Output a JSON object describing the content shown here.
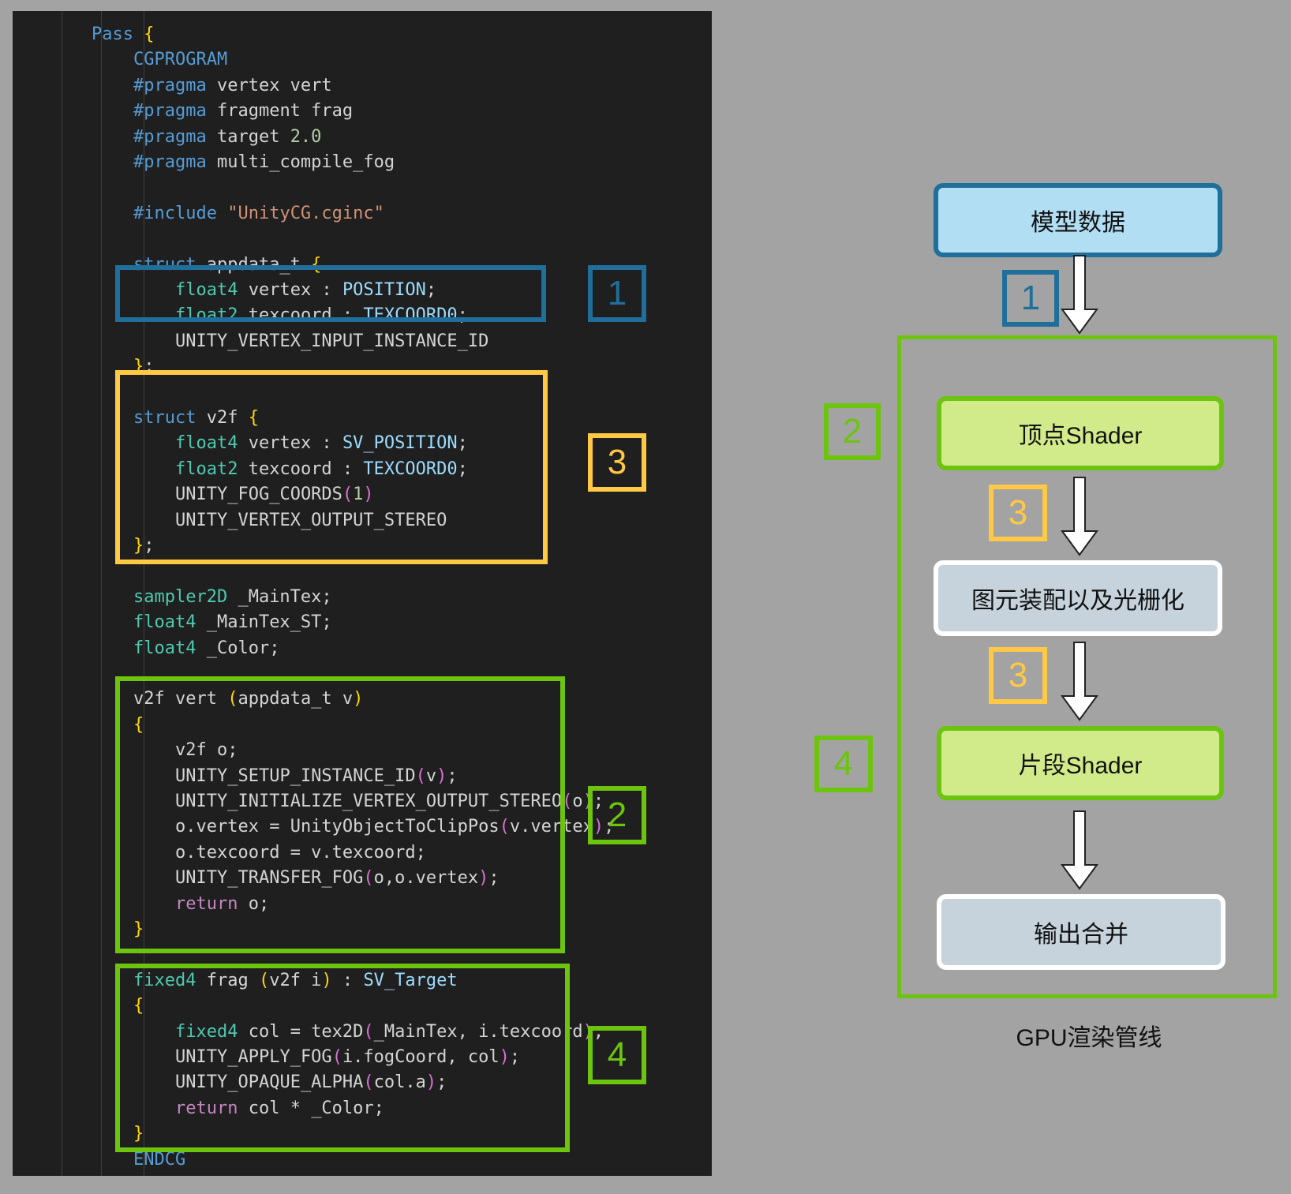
{
  "colors": {
    "blue": "#1f6f9a",
    "yellow": "#ffc845",
    "green": "#6cc40f",
    "model_node_fill": "#b1def3",
    "shader_node_fill": "#d1eb8a",
    "gray_node_fill": "#c6d3dd",
    "code_bg": "#1f1f1f",
    "page_bg": "#a3a3a3"
  },
  "code": {
    "lines": [
      [
        [
          "t-kw",
          "Pass "
        ],
        [
          "t-br",
          "{"
        ]
      ],
      [
        [
          "t-kw",
          "CGPROGRAM"
        ]
      ],
      [
        [
          "t-pre",
          "#pragma "
        ],
        [
          "t-tx",
          "vertex vert"
        ]
      ],
      [
        [
          "t-pre",
          "#pragma "
        ],
        [
          "t-tx",
          "fragment frag"
        ]
      ],
      [
        [
          "t-pre",
          "#pragma "
        ],
        [
          "t-tx",
          "target "
        ],
        [
          "t-num",
          "2.0"
        ]
      ],
      [
        [
          "t-pre",
          "#pragma "
        ],
        [
          "t-tx",
          "multi_compile_fog"
        ]
      ],
      [],
      [
        [
          "t-pre",
          "#include "
        ],
        [
          "t-str",
          "\"UnityCG.cginc\""
        ]
      ],
      [],
      [
        [
          "t-kw",
          "struct "
        ],
        [
          "t-tx",
          "appdata_t "
        ],
        [
          "t-br",
          "{"
        ]
      ],
      [
        [
          "t-type",
          "float4 "
        ],
        [
          "t-tx",
          "vertex : "
        ],
        [
          "t-pl",
          "POSITION"
        ],
        [
          "t-tx",
          ";"
        ]
      ],
      [
        [
          "t-type",
          "float2 "
        ],
        [
          "t-tx",
          "texcoord : "
        ],
        [
          "t-pl",
          "TEXCOORD0"
        ],
        [
          "t-tx",
          ";"
        ]
      ],
      [
        [
          "t-tx",
          "UNITY_VERTEX_INPUT_INSTANCE_ID"
        ]
      ],
      [
        [
          "t-br",
          "}"
        ],
        [
          "t-tx",
          ";"
        ]
      ],
      [],
      [
        [
          "t-kw",
          "struct "
        ],
        [
          "t-tx",
          "v2f "
        ],
        [
          "t-br",
          "{"
        ]
      ],
      [
        [
          "t-type",
          "float4 "
        ],
        [
          "t-tx",
          "vertex : "
        ],
        [
          "t-pl",
          "SV_POSITION"
        ],
        [
          "t-tx",
          ";"
        ]
      ],
      [
        [
          "t-type",
          "float2 "
        ],
        [
          "t-tx",
          "texcoord : "
        ],
        [
          "t-pl",
          "TEXCOORD0"
        ],
        [
          "t-tx",
          ";"
        ]
      ],
      [
        [
          "t-tx",
          "UNITY_FOG_COORDS"
        ],
        [
          "t-pa",
          "("
        ],
        [
          "t-num",
          "1"
        ],
        [
          "t-pa",
          ")"
        ]
      ],
      [
        [
          "t-tx",
          "UNITY_VERTEX_OUTPUT_STEREO"
        ]
      ],
      [
        [
          "t-br",
          "}"
        ],
        [
          "t-tx",
          ";"
        ]
      ],
      [],
      [
        [
          "t-type",
          "sampler2D "
        ],
        [
          "t-tx",
          "_MainTex;"
        ]
      ],
      [
        [
          "t-type",
          "float4 "
        ],
        [
          "t-tx",
          "_MainTex_ST;"
        ]
      ],
      [
        [
          "t-type",
          "float4 "
        ],
        [
          "t-tx",
          "_Color;"
        ]
      ],
      [],
      [
        [
          "t-tx",
          "v2f vert "
        ],
        [
          "t-br",
          "("
        ],
        [
          "t-tx",
          "appdata_t v"
        ],
        [
          "t-br",
          ")"
        ]
      ],
      [
        [
          "t-br",
          "{"
        ]
      ],
      [
        [
          "t-tx",
          "v2f o;"
        ]
      ],
      [
        [
          "t-tx",
          "UNITY_SETUP_INSTANCE_ID"
        ],
        [
          "t-pa",
          "("
        ],
        [
          "t-tx",
          "v"
        ],
        [
          "t-pa",
          ")"
        ],
        [
          "t-tx",
          ";"
        ]
      ],
      [
        [
          "t-tx",
          "UNITY_INITIALIZE_VERTEX_OUTPUT_STEREO"
        ],
        [
          "t-pa",
          "("
        ],
        [
          "t-tx",
          "o"
        ],
        [
          "t-pa",
          ")"
        ],
        [
          "t-tx",
          ";"
        ]
      ],
      [
        [
          "t-tx",
          "o.vertex = UnityObjectToClipPos"
        ],
        [
          "t-pa",
          "("
        ],
        [
          "t-tx",
          "v.vertex"
        ],
        [
          "t-pa",
          ")"
        ],
        [
          "t-tx",
          ";"
        ]
      ],
      [
        [
          "t-tx",
          "o.texcoord = v.texcoord;"
        ]
      ],
      [
        [
          "t-tx",
          "UNITY_TRANSFER_FOG"
        ],
        [
          "t-pa",
          "("
        ],
        [
          "t-tx",
          "o,o.vertex"
        ],
        [
          "t-pa",
          ")"
        ],
        [
          "t-tx",
          ";"
        ]
      ],
      [
        [
          "t-ret",
          "return "
        ],
        [
          "t-tx",
          "o;"
        ]
      ],
      [
        [
          "t-br",
          "}"
        ]
      ],
      [],
      [
        [
          "t-type",
          "fixed4 "
        ],
        [
          "t-tx",
          "frag "
        ],
        [
          "t-br",
          "("
        ],
        [
          "t-tx",
          "v2f i"
        ],
        [
          "t-br",
          ")"
        ],
        [
          "t-tx",
          " : "
        ],
        [
          "t-pl",
          "SV_Target"
        ]
      ],
      [
        [
          "t-br",
          "{"
        ]
      ],
      [
        [
          "t-type",
          "fixed4 "
        ],
        [
          "t-tx",
          "col = tex2D"
        ],
        [
          "t-pa",
          "("
        ],
        [
          "t-tx",
          "_MainTex, i.texcoord"
        ],
        [
          "t-pa",
          ")"
        ],
        [
          "t-tx",
          ";"
        ]
      ],
      [
        [
          "t-tx",
          "UNITY_APPLY_FOG"
        ],
        [
          "t-pa",
          "("
        ],
        [
          "t-tx",
          "i.fogCoord, col"
        ],
        [
          "t-pa",
          ")"
        ],
        [
          "t-tx",
          ";"
        ]
      ],
      [
        [
          "t-tx",
          "UNITY_OPAQUE_ALPHA"
        ],
        [
          "t-pa",
          "("
        ],
        [
          "t-tx",
          "col.a"
        ],
        [
          "t-pa",
          ")"
        ],
        [
          "t-tx",
          ";"
        ]
      ],
      [
        [
          "t-ret",
          "return "
        ],
        [
          "t-tx",
          "col * _Color;"
        ]
      ],
      [
        [
          "t-br",
          "}"
        ]
      ],
      [
        [
          "t-kw",
          "ENDCG"
        ]
      ]
    ]
  },
  "labels": {
    "code_1": "1",
    "code_3": "3",
    "code_2": "2",
    "code_4": "4",
    "pipe_1": "1",
    "pipe_2": "2",
    "pipe_3a": "3",
    "pipe_3b": "3",
    "pipe_4": "4"
  },
  "pipeline": {
    "model_data": "模型数据",
    "vertex_shader": "顶点Shader",
    "primitive_assembly": "图元装配以及光栅化",
    "fragment_shader": "片段Shader",
    "output_merge": "输出合并",
    "caption": "GPU渲染管线"
  }
}
